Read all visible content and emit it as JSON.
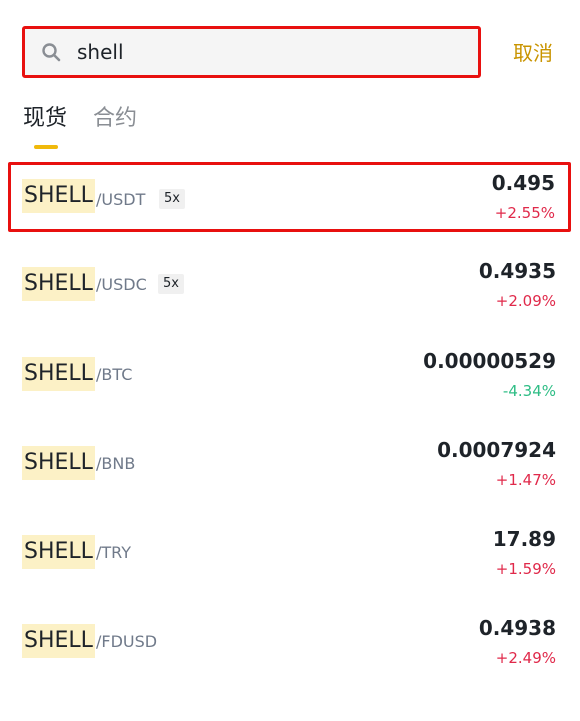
{
  "search": {
    "value": "shell",
    "cancel_label": "取消"
  },
  "tabs": [
    {
      "label": "现货",
      "active": true
    },
    {
      "label": "合约",
      "active": false
    }
  ],
  "pairs": [
    {
      "base": "SHELL",
      "quote": "/USDT",
      "leverage": "5x",
      "price": "0.495",
      "change": "+2.55%",
      "direction": "up"
    },
    {
      "base": "SHELL",
      "quote": "/USDC",
      "leverage": "5x",
      "price": "0.4935",
      "change": "+2.09%",
      "direction": "up"
    },
    {
      "base": "SHELL",
      "quote": "/BTC",
      "leverage": "",
      "price": "0.00000529",
      "change": "-4.34%",
      "direction": "down"
    },
    {
      "base": "SHELL",
      "quote": "/BNB",
      "leverage": "",
      "price": "0.0007924",
      "change": "+1.47%",
      "direction": "up"
    },
    {
      "base": "SHELL",
      "quote": "/TRY",
      "leverage": "",
      "price": "17.89",
      "change": "+1.59%",
      "direction": "up"
    },
    {
      "base": "SHELL",
      "quote": "/FDUSD",
      "leverage": "",
      "price": "0.4938",
      "change": "+2.49%",
      "direction": "up"
    }
  ],
  "colors": {
    "accent": "#f0b90b",
    "cancel": "#c99400",
    "up": "#e0294a",
    "down": "#2ebd85",
    "highlight_border": "#e8100f"
  }
}
